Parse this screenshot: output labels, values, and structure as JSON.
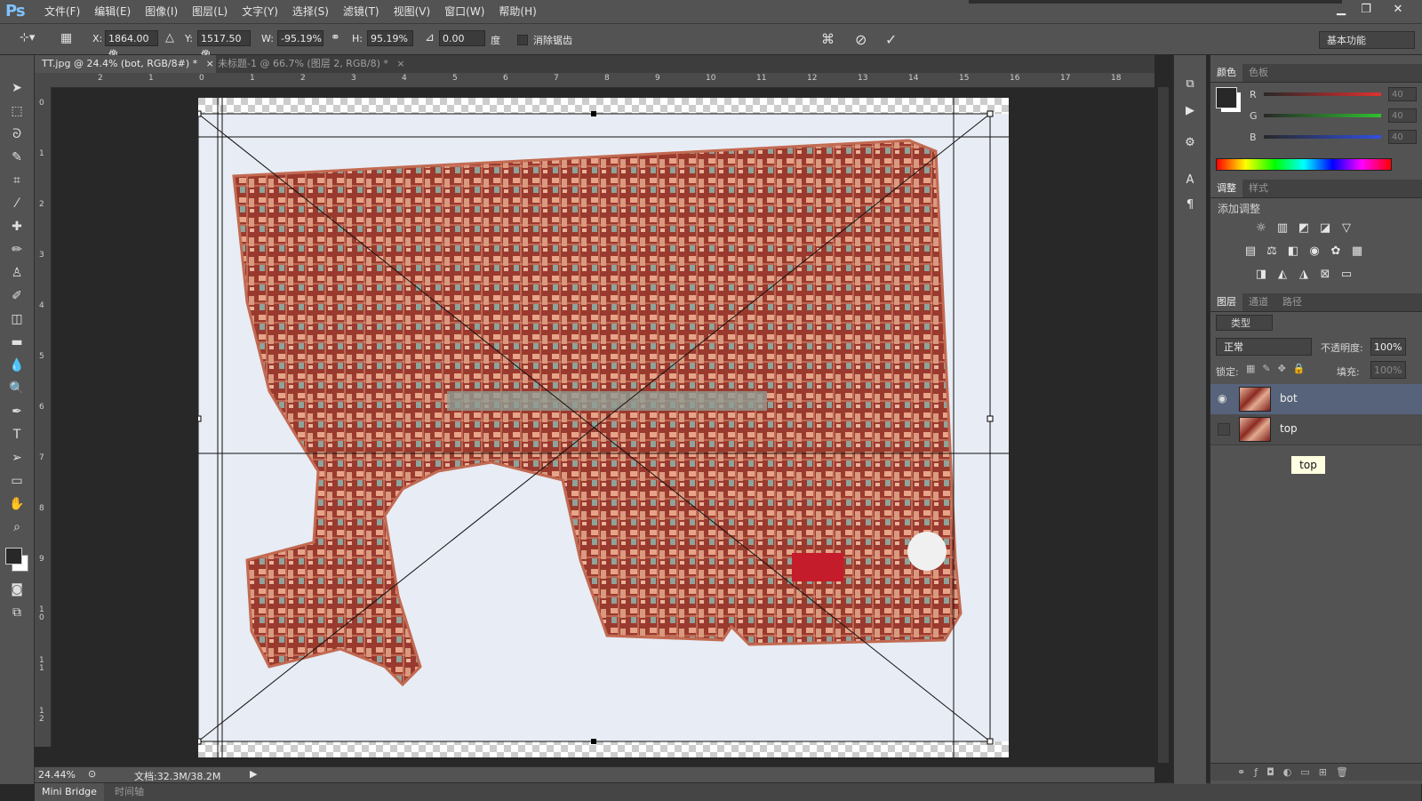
{
  "app": {
    "logo": "Ps"
  },
  "menu": [
    "文件(F)",
    "编辑(E)",
    "图像(I)",
    "图层(L)",
    "文字(Y)",
    "选择(S)",
    "滤镜(T)",
    "视图(V)",
    "窗口(W)",
    "帮助(H)"
  ],
  "window_controls": {
    "minimize": "▁",
    "restore": "❐",
    "close": "✕"
  },
  "options": {
    "x_label": "X:",
    "x_value": "1864.00 像",
    "y_label": "Y:",
    "y_value": "1517.50 像",
    "w_label": "W:",
    "w_value": "-95.19%",
    "h_label": "H:",
    "h_value": "95.19%",
    "angle_value": "0.00",
    "angle_unit": "度",
    "antialias_label": "消除锯齿",
    "workspace": "基本功能"
  },
  "tabs": [
    {
      "label": "TT.jpg @ 24.4% (bot, RGB/8#) *",
      "close": "×"
    },
    {
      "label": "未标题-1 @ 66.7% (图层 2, RGB/8) *",
      "close": "×"
    }
  ],
  "rulers": {
    "h": [
      "2",
      "1",
      "0",
      "1",
      "2",
      "3",
      "4",
      "5",
      "6",
      "7",
      "8",
      "9",
      "10",
      "11",
      "12",
      "13",
      "14",
      "15",
      "16",
      "17",
      "18"
    ],
    "v": [
      "0",
      "1",
      "2",
      "3",
      "4",
      "5",
      "6",
      "7",
      "8",
      "9",
      "1 0",
      "1 1",
      "1 2"
    ]
  },
  "status": {
    "zoom": "24.44%",
    "doc": "文档:32.3M/38.2M"
  },
  "bottom_tabs": [
    "Mini Bridge",
    "时间轴"
  ],
  "color_panel": {
    "tabs": [
      "颜色",
      "色板"
    ],
    "channels": [
      {
        "name": "R",
        "value": "40",
        "color": "#e03030"
      },
      {
        "name": "G",
        "value": "40",
        "color": "#30c030"
      },
      {
        "name": "B",
        "value": "40",
        "color": "#3050e0"
      }
    ]
  },
  "adjust_panel": {
    "tabs": [
      "调整",
      "样式"
    ],
    "title": "添加调整"
  },
  "layers_panel": {
    "tabs": [
      "图层",
      "通道",
      "路径"
    ],
    "filter_label": "类型",
    "blend_mode": "正常",
    "opacity_label": "不透明度:",
    "opacity_value": "100%",
    "lock_label": "锁定:",
    "fill_label": "填充:",
    "fill_value": "100%",
    "layers": [
      {
        "name": "bot",
        "visible": true,
        "selected": true
      },
      {
        "name": "top",
        "visible": false,
        "selected": false
      }
    ],
    "tooltip": "top"
  }
}
